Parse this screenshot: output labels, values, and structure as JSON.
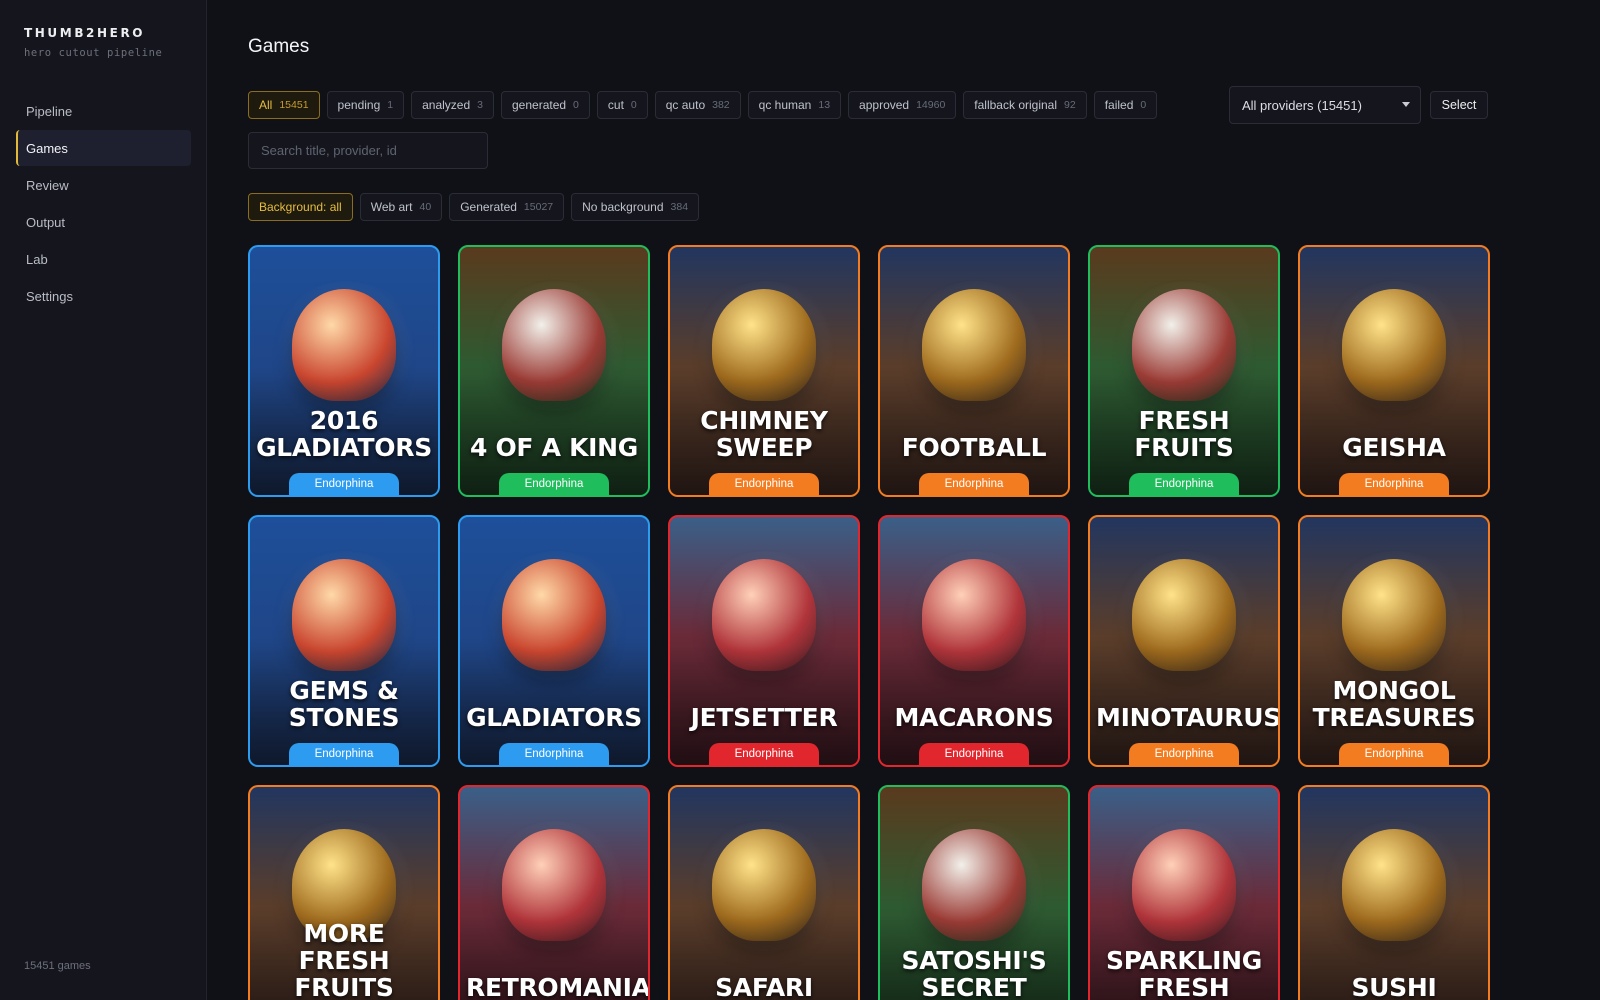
{
  "sidebar": {
    "brand": "THUMB2HERO",
    "subtitle": "hero cutout pipeline",
    "nav": [
      "Pipeline",
      "Games",
      "Review",
      "Output",
      "Lab",
      "Settings"
    ],
    "active": "Games",
    "footer": "15451 games"
  },
  "page": {
    "title": "Games"
  },
  "status_filters": [
    {
      "label": "All",
      "count": "15451",
      "active": true
    },
    {
      "label": "pending",
      "count": "1"
    },
    {
      "label": "analyzed",
      "count": "3"
    },
    {
      "label": "generated",
      "count": "0"
    },
    {
      "label": "cut",
      "count": "0"
    },
    {
      "label": "qc auto",
      "count": "382"
    },
    {
      "label": "qc human",
      "count": "13"
    },
    {
      "label": "approved",
      "count": "14960"
    },
    {
      "label": "fallback original",
      "count": "92"
    },
    {
      "label": "failed",
      "count": "0"
    }
  ],
  "provider_select": {
    "value": "All providers (15451)"
  },
  "select_button": "Select",
  "search": {
    "placeholder": "Search title, provider, id",
    "value": ""
  },
  "background_filters": [
    {
      "label": "Background: all",
      "count": "",
      "active": true
    },
    {
      "label": "Web art",
      "count": "40"
    },
    {
      "label": "Generated",
      "count": "15027"
    },
    {
      "label": "No background",
      "count": "384"
    }
  ],
  "accent_colors": {
    "blue": "#2d9cf0",
    "green": "#1fbd5c",
    "orange": "#f47c20",
    "red": "#e2262d",
    "active_filter": "#e2b93b"
  },
  "games": [
    {
      "title": "2016 GLADIATORS",
      "provider": "Endorphina",
      "color": "blue",
      "icon": "soccer-gladiator-icon"
    },
    {
      "title": "4 OF A KING",
      "provider": "Endorphina",
      "color": "green",
      "icon": "playing-cards-icon"
    },
    {
      "title": "CHIMNEY SWEEP",
      "provider": "Endorphina",
      "color": "orange",
      "icon": "chimney-sweep-icon"
    },
    {
      "title": "FOOTBALL",
      "provider": "Endorphina",
      "color": "orange",
      "icon": "football-mascot-icon"
    },
    {
      "title": "FRESH FRUITS",
      "provider": "Endorphina",
      "color": "green",
      "icon": "watermelon-strawberry-icon"
    },
    {
      "title": "GEISHA",
      "provider": "Endorphina",
      "color": "orange",
      "icon": "geisha-icon"
    },
    {
      "title": "GEMS & STONES",
      "provider": "Endorphina",
      "color": "blue",
      "icon": "gemstones-icon"
    },
    {
      "title": "GLADIATORS",
      "provider": "Endorphina",
      "color": "blue",
      "icon": "seahorse-chariot-icon"
    },
    {
      "title": "JETSETTER",
      "provider": "Endorphina",
      "color": "red",
      "icon": "woman-money-icon"
    },
    {
      "title": "MACARONS",
      "provider": "Endorphina",
      "color": "red",
      "icon": "macarons-icon"
    },
    {
      "title": "MINOTAURUS",
      "provider": "Endorphina",
      "color": "orange",
      "icon": "minotaur-icon"
    },
    {
      "title": "MONGOL TREASURES",
      "provider": "Endorphina",
      "color": "orange",
      "icon": "white-horse-icon"
    },
    {
      "title": "MORE FRESH FRUITS",
      "provider": "",
      "color": "orange",
      "icon": "star-fruit-icon"
    },
    {
      "title": "RETROMANIA",
      "provider": "",
      "color": "red",
      "icon": "retro-woman-icon"
    },
    {
      "title": "SAFARI",
      "provider": "",
      "color": "orange",
      "icon": "lion-icon"
    },
    {
      "title": "SATOSHI'S SECRET",
      "provider": "",
      "color": "green",
      "icon": "hooded-figure-icon"
    },
    {
      "title": "SPARKLING FRESH",
      "provider": "",
      "color": "red",
      "icon": "raspberry-icon"
    },
    {
      "title": "SUSHI",
      "provider": "",
      "color": "orange",
      "icon": "sushi-chopsticks-icon"
    }
  ]
}
